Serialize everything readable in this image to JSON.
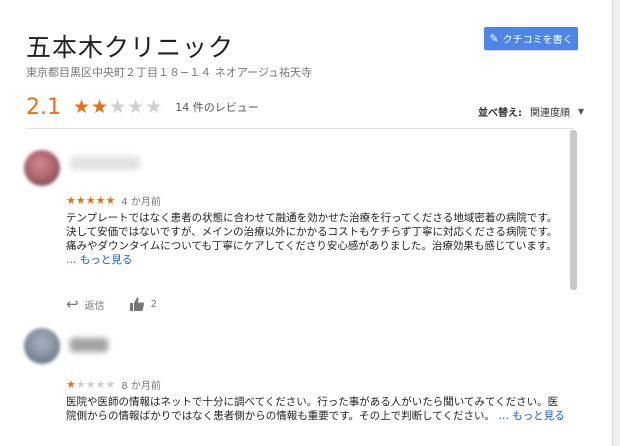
{
  "place": {
    "title": "五本木クリニック",
    "address": "東京都目黒区中央町２丁目１８−１４ ネオアージュ祐天寺"
  },
  "write_review_button": {
    "label": "クチコミを書く",
    "icon": "pencil-icon"
  },
  "rating": {
    "value": "2.1",
    "stars": 2,
    "max_stars": 5,
    "count_label": "14 件のレビュー"
  },
  "sort": {
    "label": "並べ替え:",
    "value": "関連度順"
  },
  "reviews": [
    {
      "stars": 5,
      "time": "4 か月前",
      "text": "テンプレートではなく患者の状態に合わせて融通を効かせた治療を行ってくださる地域密着の病院です。\n決して安価ではないですが、メインの治療以外にかかるコストもケチらず丁寧に対応くださる病院です。痛みやダウンタイムについても丁寧にケアしてくださり安心感がありました。治療効果も感じています。",
      "more_label": "… もっと見る",
      "reply_label": "返信",
      "likes": "2"
    },
    {
      "stars": 1,
      "time": "8 か月前",
      "text": "医院や医師の情報はネットで十分に調べてください。行った事がある人がいたら聞いてみてください。医院側からの情報ばかりではなく患者側からの情報も重要です。その上で判断してください。",
      "more_label": "… もっと見る"
    }
  ],
  "colors": {
    "star": "#e7711b",
    "button": "#4d86e8",
    "link": "#1a5ad6"
  }
}
